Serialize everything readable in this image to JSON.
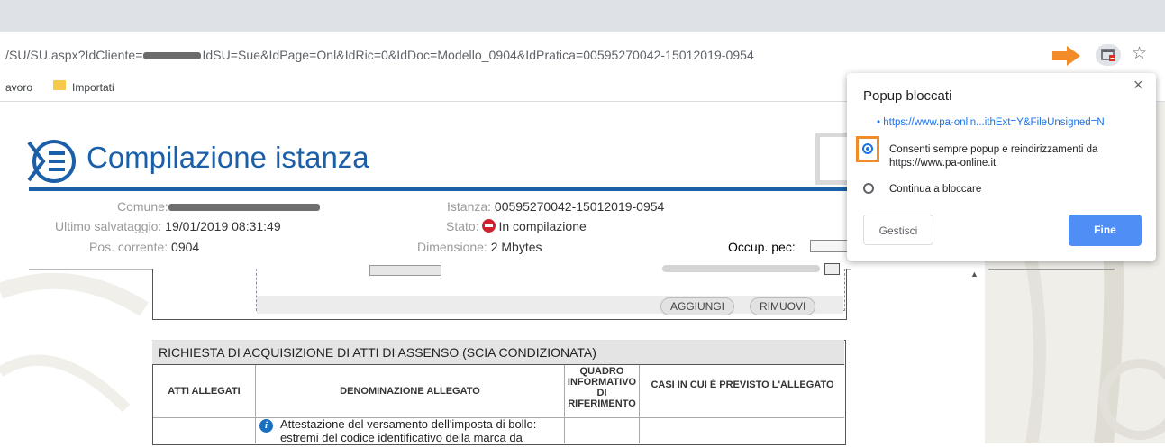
{
  "browser": {
    "url_prefix": "/SU/SU.aspx?IdCliente=",
    "url_suffix": "IdSU=Sue&IdPage=Onl&IdRic=0&IdDoc=Modello_0904&IdPratica=00595270042-15012019-0954",
    "bookmarks": [
      "avoro",
      "Importati"
    ],
    "colors": {
      "arrow": "#f28c28",
      "toolbar": "#dee1e6"
    }
  },
  "page": {
    "title": "Compilazione istanza",
    "info": {
      "comune_label": "Comune:",
      "ultimo_label": "Ultimo salvataggio:",
      "ultimo_value": "19/01/2019 08:31:49",
      "pos_label": "Pos. corrente:",
      "pos_value": "0904",
      "istanza_label": "Istanza:",
      "istanza_value": "00595270042-15012019-0954",
      "stato_label": "Stato:",
      "stato_value": "In compilazione",
      "dimensione_label": "Dimensione:",
      "dimensione_value": "2 Mbytes",
      "occup_label": "Occup. pec:"
    },
    "buttons": {
      "aggiungi": "AGGIUNGI",
      "rimuovi": "RIMUOVI"
    },
    "table": {
      "title": "RICHIESTA DI ACQUISIZIONE DI ATTI DI ASSENSO (SCIA CONDIZIONATA)",
      "headers": [
        "ATTI ALLEGATI",
        "DENOMINAZIONE ALLEGATO",
        "QUADRO INFORMATIVO DI RIFERIMENTO",
        "CASI IN CUI È PREVISTO L'ALLEGATO"
      ],
      "row_text": "Attestazione del versamento dell'imposta di bollo: estremi del codice identificativo della marca da"
    }
  },
  "popup": {
    "title": "Popup bloccati",
    "link": "https://www.pa-onlin...ithExt=Y&FileUnsigned=N",
    "option_allow": "Consenti sempre popup e reindirizzamenti da https://www.pa-online.it",
    "option_block": "Continua a bloccare",
    "manage_button": "Gestisci",
    "done_button": "Fine",
    "close": "×"
  }
}
